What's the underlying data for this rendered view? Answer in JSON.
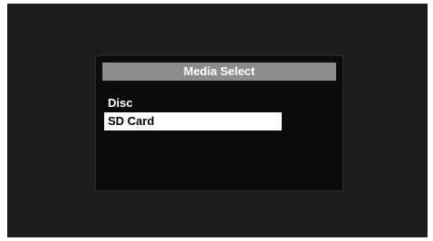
{
  "dialog": {
    "title": "Media Select",
    "options": [
      {
        "label": "Disc",
        "selected": false
      },
      {
        "label": "SD Card",
        "selected": true
      }
    ]
  },
  "colors": {
    "screen_background": "#1c1c1c",
    "dialog_background": "#0b0b0b",
    "title_bar": "#8c8c8c",
    "selection_highlight": "#ffffff"
  }
}
